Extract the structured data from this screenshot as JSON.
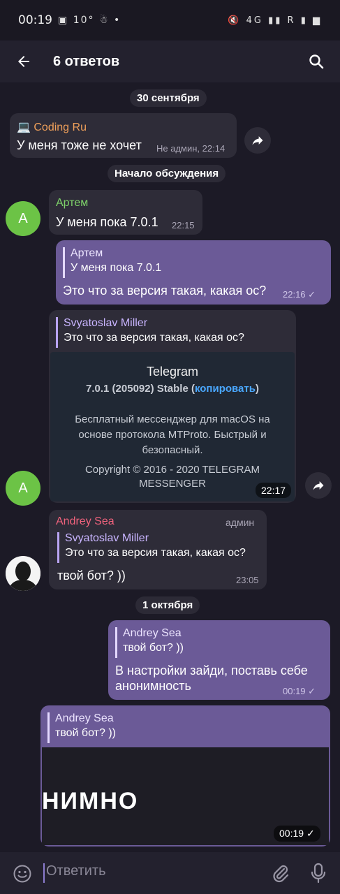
{
  "status_bar": {
    "time": "00:19",
    "temperature": "10°",
    "network": "4G",
    "signal": "R"
  },
  "header": {
    "title": "6 ответов",
    "back_icon": "back-arrow-icon",
    "search_icon": "search-icon"
  },
  "dates": {
    "first": "30 сентября",
    "discussion": "Начало обсуждения",
    "second": "1 октября"
  },
  "messages": {
    "m1": {
      "sender": "💻 Coding Ru",
      "text": "У меня тоже не хочет",
      "meta": "Не админ, 22:14"
    },
    "m2": {
      "sender": "Артем",
      "text": "У меня пока 7.0.1",
      "time": "22:15",
      "avatar": "A"
    },
    "m3": {
      "reply_name": "Артем",
      "reply_text": "У меня пока 7.0.1",
      "text": "Это что за версия такая, какая ос?",
      "time": "22:16"
    },
    "m4": {
      "reply_name": "Svyatoslav Miller",
      "reply_text": "Это что за версия такая, какая ос?",
      "shot_title": "Telegram",
      "shot_version": "7.0.1 (205092) Stable (",
      "shot_copy": "копировать",
      "shot_version_end": ")",
      "shot_desc1": "Бесплатный мессенджер для macOS на",
      "shot_desc2": "основе протокола MTProto. Быстрый и",
      "shot_desc3": "безопасный.",
      "shot_copyright1": "Copyright © 2016 - 2020 TELEGRAM",
      "shot_copyright2": "MESSENGER",
      "time": "22:17",
      "avatar": "A"
    },
    "m5": {
      "sender": "Andrey Sea",
      "badge": "админ",
      "reply_name": "Svyatoslav Miller",
      "reply_text": "Это что за версия такая, какая ос?",
      "text": "твой бот? ))",
      "time": "23:05"
    },
    "m6": {
      "reply_name": "Andrey Sea",
      "reply_text": "твой бот? ))",
      "text1": "В настройки зайди, поставь себе",
      "text2": "анонимность",
      "time": "00:19"
    },
    "m7": {
      "reply_name": "Andrey Sea",
      "reply_text": "твой бот? ))",
      "video_text": "НИМНО",
      "time": "00:19"
    }
  },
  "input": {
    "placeholder": "Ответить"
  },
  "colors": {
    "accent": "#6b5a97",
    "green_avatar": "#6cc346",
    "link": "#4aa8ff",
    "sender_orange": "#f0a05a",
    "sender_green": "#7ed36a",
    "sender_red": "#f2637d"
  }
}
